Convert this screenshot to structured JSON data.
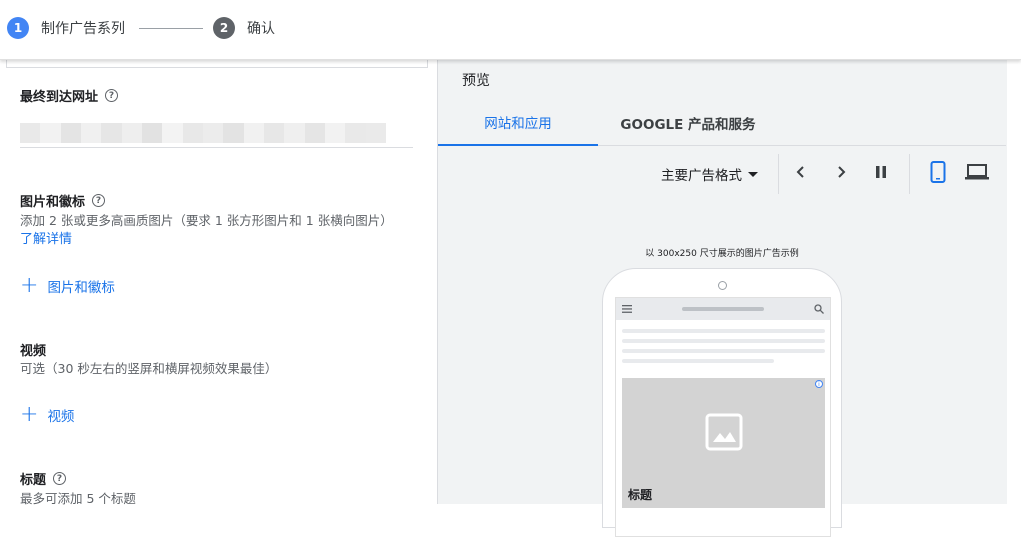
{
  "stepper": {
    "step1": {
      "number": "1",
      "label": "制作广告系列"
    },
    "step2": {
      "number": "2",
      "label": "确认"
    }
  },
  "form": {
    "final_url": {
      "label": "最终到达网址",
      "help_icon": "help-circle-icon"
    },
    "images": {
      "label": "图片和徽标",
      "help_icon": "help-circle-icon",
      "description": "添加 2 张或更多高画质图片（要求 1 张方形图片和 1 张横向图片）",
      "learn_more": "了解详情",
      "add_button": "图片和徽标"
    },
    "video": {
      "label": "视频",
      "description": "可选（30 秒左右的竖屏和横屏视频效果最佳）",
      "add_button": "视频"
    },
    "headline": {
      "label": "标题",
      "help_icon": "help-circle-icon",
      "description": "最多可添加 5 个标题"
    }
  },
  "preview": {
    "title": "预览",
    "tabs": [
      {
        "label": "网站和应用",
        "active": true
      },
      {
        "label": "GOOGLE 产品和服务",
        "active": false
      }
    ],
    "format_select": "主要广告格式",
    "toolbar_icons": [
      "chevron-left-icon",
      "chevron-right-icon",
      "pause-icon",
      "phone-icon",
      "laptop-icon"
    ],
    "caption": "以 300x250 尺寸展示的图片广告示例",
    "ad_title": "标题",
    "accent_color": "#1a73e8"
  }
}
